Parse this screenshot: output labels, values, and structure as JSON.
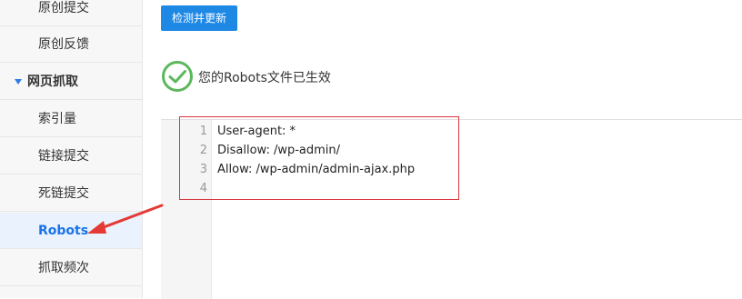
{
  "sidebar": {
    "items": [
      {
        "label": "原创提交"
      },
      {
        "label": "原创反馈"
      },
      {
        "label": "网页抓取"
      },
      {
        "label": "索引量"
      },
      {
        "label": "链接提交"
      },
      {
        "label": "死链提交"
      },
      {
        "label": "Robots"
      },
      {
        "label": "抓取频次"
      }
    ]
  },
  "main": {
    "check_button_label": "检测并更新",
    "status_text": "您的Robots文件已生效",
    "status_icon": "check-circle-icon",
    "editor": {
      "line_numbers": [
        "1",
        "2",
        "3",
        "4"
      ],
      "lines": [
        "User-agent: *",
        "Disallow: /wp-admin/",
        "Allow: /wp-admin/admin-ajax.php",
        ""
      ]
    }
  },
  "colors": {
    "accent": "#1e88e5",
    "success": "#5cb85c",
    "annotation": "#e53935"
  }
}
